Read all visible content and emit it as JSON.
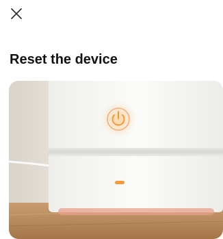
{
  "header": {
    "close_icon": "close-icon"
  },
  "page": {
    "title": "Reset the device"
  },
  "illustration": {
    "subject": "device-photo",
    "power_icon": "power-icon",
    "indicator": "status-light",
    "colors": {
      "accent_orange": "#f39a3a",
      "wall": "#e9e6df",
      "table": "#b98a5c",
      "device_body": "#f6f6f3"
    }
  }
}
